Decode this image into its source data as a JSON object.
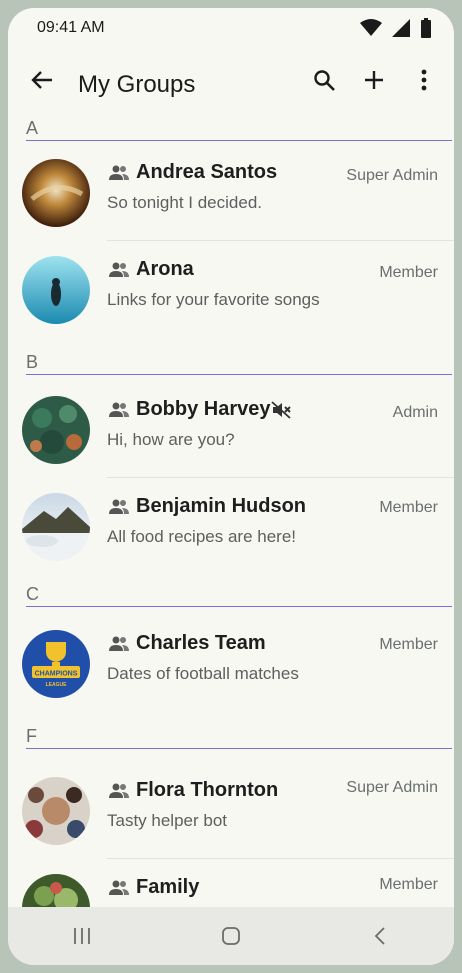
{
  "status": {
    "time": "09:41 AM",
    "icons": [
      "wifi-icon",
      "cell-signal-icon",
      "battery-icon"
    ]
  },
  "appbar": {
    "title": "My Groups",
    "icons": [
      "back-arrow-icon",
      "search-icon",
      "plus-icon",
      "more-vert-icon"
    ]
  },
  "sections": [
    {
      "letter": "A"
    },
    {
      "letter": "B"
    },
    {
      "letter": "C"
    },
    {
      "letter": "F"
    }
  ],
  "groups": [
    {
      "name": "Andrea Santos",
      "subtitle": "So tonight I decided.",
      "role": "Super Admin"
    },
    {
      "name": "Arona",
      "subtitle": "Links for your favorite songs",
      "role": "Member"
    },
    {
      "name": "Bobby Harvey",
      "subtitle": "Hi, how are you?",
      "role": "Admin",
      "muted": true
    },
    {
      "name": "Benjamin Hudson",
      "subtitle": "All food recipes are here!",
      "role": "Member"
    },
    {
      "name": "Charles Team",
      "subtitle": "Dates of football matches",
      "role": "Member"
    },
    {
      "name": "Flora Thornton",
      "subtitle": "Tasty helper bot",
      "role": "Super Admin"
    },
    {
      "name": "Family",
      "subtitle": "",
      "role": "Member"
    }
  ],
  "avatar_logo": {
    "line1": "CHAMPIONS",
    "line2": "LEAGUE"
  },
  "navbar": {
    "icons": [
      "recent-apps-icon",
      "home-icon",
      "back-icon"
    ]
  },
  "colors": {
    "accent": "#7b6fd6",
    "background": "#f8f8f2",
    "frame": "#b9c4b8"
  }
}
